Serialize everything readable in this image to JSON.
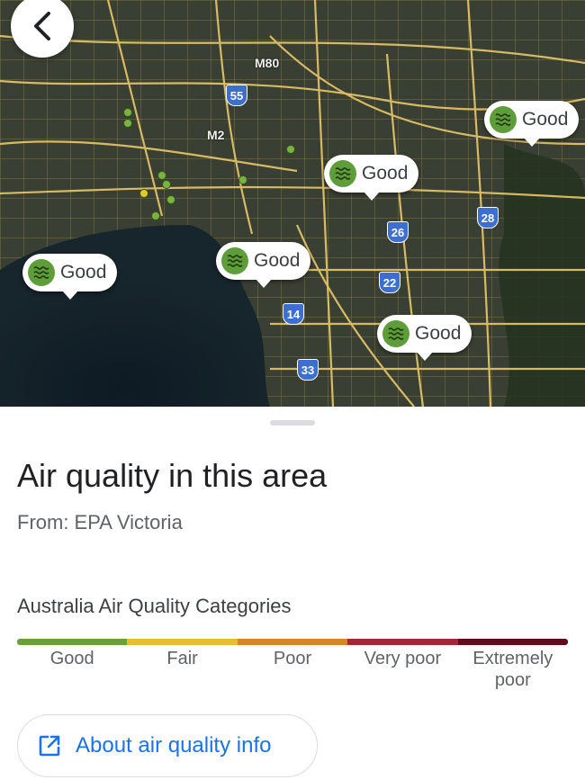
{
  "map": {
    "road_labels": [
      "M80",
      "M2"
    ],
    "route_shields": [
      "55",
      "26",
      "28",
      "22",
      "14",
      "33"
    ],
    "markers": [
      {
        "label": "Good",
        "icon": "air-quality-waves-icon"
      },
      {
        "label": "Good",
        "icon": "air-quality-waves-icon"
      },
      {
        "label": "Good",
        "icon": "air-quality-waves-icon"
      },
      {
        "label": "Good",
        "icon": "air-quality-waves-icon"
      },
      {
        "label": "Good",
        "icon": "air-quality-waves-icon"
      }
    ]
  },
  "sheet": {
    "title": "Air quality in this area",
    "source": "From: EPA Victoria",
    "scale_title": "Australia Air Quality Categories",
    "categories": [
      {
        "label": "Good",
        "color": "#6a9e3e"
      },
      {
        "label": "Fair",
        "color": "#e3c030"
      },
      {
        "label": "Poor",
        "color": "#d48627"
      },
      {
        "label": "Very poor",
        "color": "#a42738"
      },
      {
        "label": "Extremely poor",
        "color": "#5e0e1b"
      }
    ],
    "about_button": "About air quality info"
  },
  "colors": {
    "accent": "#1a73e8",
    "good_icon": "#5f9c3a",
    "shield": "#3d6fd1"
  }
}
